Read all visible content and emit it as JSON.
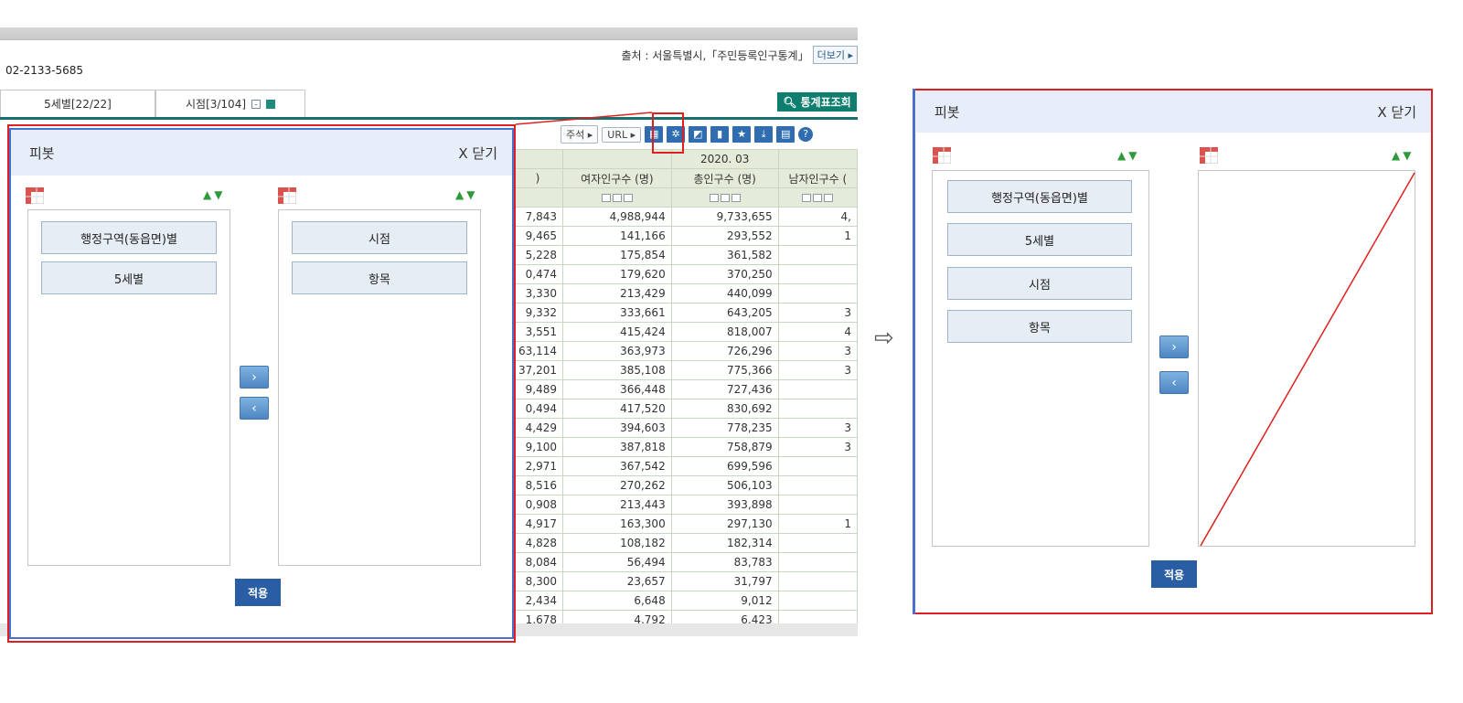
{
  "source": {
    "label": "출처 : 서울특별시,「주민등록인구통계」",
    "more": "더보기"
  },
  "phone": "02-2133-5685",
  "tabs": [
    {
      "label": "5세별[22/22]"
    },
    {
      "label": "시점[3/104]"
    }
  ],
  "search_button": "통계표조회",
  "toolbar": {
    "note": "주석",
    "url": "URL"
  },
  "table": {
    "period": "2020. 03",
    "headers": [
      "여자인구수 (명)",
      "총인구수 (명)",
      "남자인구수 ("
    ],
    "left_partial": [
      "7,843",
      "9,465",
      "5,228",
      "0,474",
      "3,330",
      "9,332",
      "3,551",
      "63,114",
      "37,201",
      "9,489",
      "0,494",
      "4,429",
      "9,100",
      "2,971",
      "8,516",
      "0,908",
      "4,917",
      "4,828",
      "8,084",
      "8,300",
      "2,434",
      "1,678"
    ],
    "female": [
      "4,988,944",
      "141,166",
      "175,854",
      "179,620",
      "213,429",
      "333,661",
      "415,424",
      "363,973",
      "385,108",
      "366,448",
      "417,520",
      "394,603",
      "387,818",
      "367,542",
      "270,262",
      "213,443",
      "163,300",
      "108,182",
      "56,494",
      "23,657",
      "6,648",
      "4,792"
    ],
    "total": [
      "9,733,655",
      "293,552",
      "361,582",
      "370,250",
      "440,099",
      "643,205",
      "818,007",
      "726,296",
      "775,366",
      "727,436",
      "830,692",
      "778,235",
      "758,879",
      "699,596",
      "506,103",
      "393,898",
      "297,130",
      "182,314",
      "83,783",
      "31,797",
      "9,012",
      "6,423"
    ],
    "male_partial": [
      "4,",
      "1",
      "",
      "",
      "",
      "3",
      "4",
      "3",
      "3",
      "",
      "",
      "3",
      "3",
      "",
      "",
      "",
      "1",
      "",
      "",
      "",
      "",
      ""
    ]
  },
  "left_pivot": {
    "title": "피봇",
    "close": "X 닫기",
    "row_items": [
      "행정구역(동읍면)별",
      "5세별"
    ],
    "col_items": [
      "시점",
      "항목"
    ],
    "move_right": "›",
    "move_left": "‹",
    "apply": "적용"
  },
  "right_pivot": {
    "title": "피봇",
    "close": "X 닫기",
    "row_items": [
      "행정구역(동읍면)별",
      "5세별",
      "시점",
      "항목"
    ],
    "move_right": "›",
    "move_left": "‹",
    "apply": "적용"
  },
  "colors": {
    "highlight_red": "#e02020",
    "teal": "#0e7f6f",
    "pivot_header_bg": "#e8eef9",
    "apply_blue": "#2a5ea4"
  }
}
